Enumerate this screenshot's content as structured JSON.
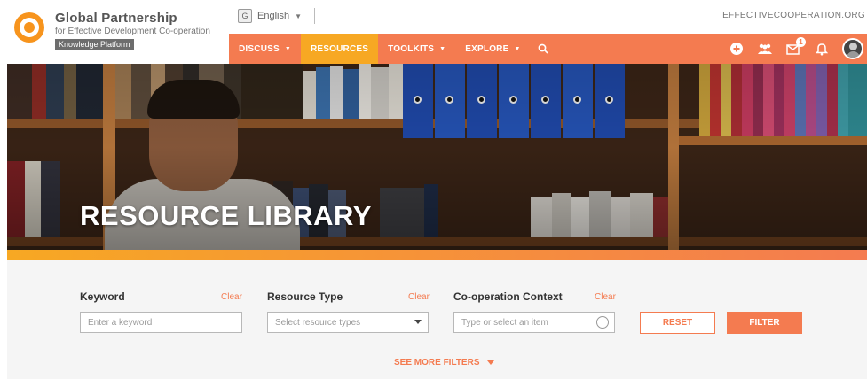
{
  "brand": {
    "title": "Global Partnership",
    "subtitle": "for Effective Development Co-operation",
    "tag": "Knowledge Platform"
  },
  "language": {
    "label": "English",
    "icon": "translate-icon"
  },
  "site_url": "EFFECTIVECOOPERATION.ORG",
  "nav": {
    "items": [
      {
        "label": "DISCUSS",
        "has_caret": true,
        "active": false
      },
      {
        "label": "RESOURCES",
        "has_caret": false,
        "active": true
      },
      {
        "label": "TOOLKITS",
        "has_caret": true,
        "active": false
      },
      {
        "label": "EXPLORE",
        "has_caret": true,
        "active": false
      }
    ],
    "icons": [
      "plus-circle-icon",
      "community-icon",
      "messages-icon",
      "bell-icon"
    ],
    "messages_badge": "1"
  },
  "hero": {
    "title": "RESOURCE LIBRARY"
  },
  "filters": {
    "keyword": {
      "label": "Keyword",
      "clear": "Clear",
      "placeholder": "Enter a keyword"
    },
    "resource_type": {
      "label": "Resource Type",
      "clear": "Clear",
      "placeholder": "Select resource types"
    },
    "context": {
      "label": "Co-operation Context",
      "clear": "Clear",
      "placeholder": "Type or select an item"
    },
    "reset_label": "RESET",
    "filter_label": "FILTER",
    "see_more_label": "SEE MORE FILTERS"
  },
  "colors": {
    "accent": "#f47b50",
    "active": "#f7a823"
  }
}
